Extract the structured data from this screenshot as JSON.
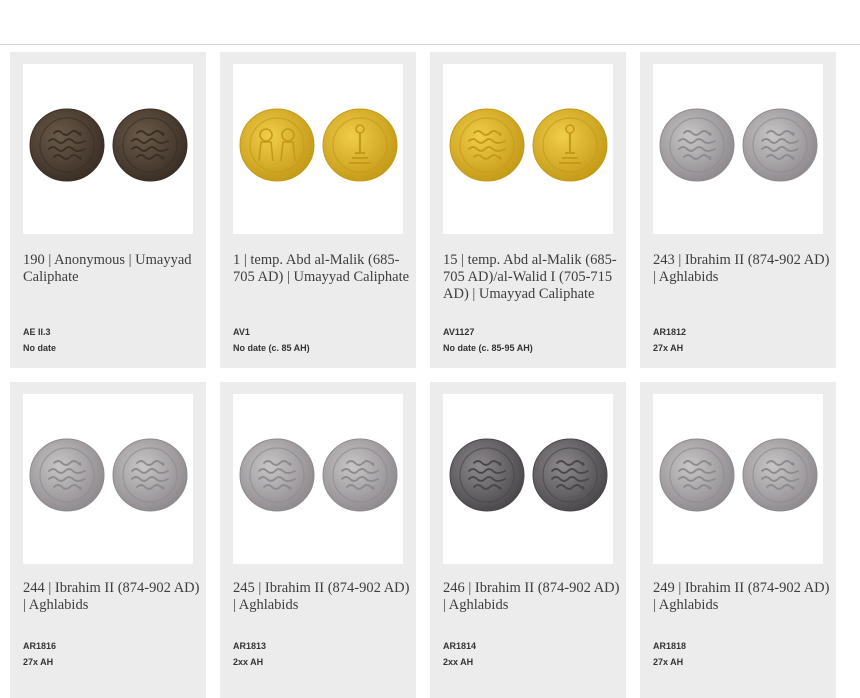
{
  "coins": [
    {
      "title": "190 | Anonymous | Umayyad Caliphate",
      "ref": "AE II.3",
      "date": "No date",
      "metal": "bronze",
      "image": "coin-bronze-kufic"
    },
    {
      "title": "1 | temp. Abd al-Malik (685-705 AD) | Umayyad Caliphate",
      "ref": "AV1",
      "date": "No date (c. 85 AH)",
      "metal": "gold",
      "image": "coin-gold-figures"
    },
    {
      "title": "15 | temp. Abd al-Malik (685-705 AD)/al-Walid I (705-715 AD) | Umayyad Caliphate",
      "ref": "AV1127",
      "date": "No date (c. 85-95 AH)",
      "metal": "gold",
      "image": "coin-gold-inscription"
    },
    {
      "title": "243 | Ibrahim II (874-902 AD) | Aghlabids",
      "ref": "AR1812",
      "date": "27x AH",
      "metal": "silver",
      "image": "coin-silver-dirham"
    },
    {
      "title": "244 | Ibrahim II (874-902 AD) | Aghlabids",
      "ref": "AR1816",
      "date": "27x AH",
      "metal": "silver",
      "image": "coin-silver-dirham"
    },
    {
      "title": "245 | Ibrahim II (874-902 AD) | Aghlabids",
      "ref": "AR1813",
      "date": "2xx AH",
      "metal": "silver",
      "image": "coin-silver-dirham"
    },
    {
      "title": "246 | Ibrahim II (874-902 AD) | Aghlabids",
      "ref": "AR1814",
      "date": "2xx AH",
      "metal": "dark-silver",
      "image": "coin-silver-dirham"
    },
    {
      "title": "249 | Ibrahim II (874-902 AD) | Aghlabids",
      "ref": "AR1818",
      "date": "27x AH",
      "metal": "silver",
      "image": "coin-silver-dirham"
    }
  ],
  "colors": {
    "bronze": [
      "#6b5a48",
      "#3a2f26"
    ],
    "gold": [
      "#f1cd4a",
      "#c49a18"
    ],
    "silver": [
      "#c9c6c8",
      "#8e8a8d"
    ],
    "dark-silver": [
      "#8e8a8e",
      "#4a474a"
    ]
  }
}
